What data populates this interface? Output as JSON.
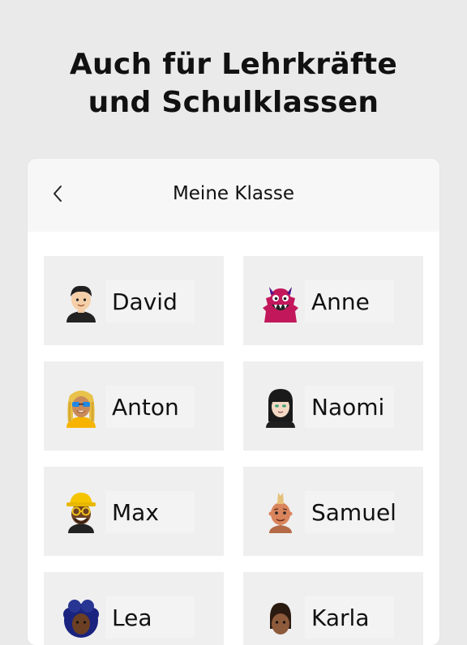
{
  "headline": {
    "line1": "Auch für Lehrkräfte",
    "line2": "und Schulklassen"
  },
  "screen": {
    "title": "Meine Klasse",
    "back_icon": "chevron-left-icon"
  },
  "students": [
    {
      "name": "David",
      "avatar": "boy-avatar-icon"
    },
    {
      "name": "Anne",
      "avatar": "pink-monster-avatar-icon"
    },
    {
      "name": "Anton",
      "avatar": "blonde-sunglasses-avatar-icon"
    },
    {
      "name": "Naomi",
      "avatar": "dark-hair-girl-avatar-icon"
    },
    {
      "name": "Max",
      "avatar": "yellow-hat-glasses-avatar-icon"
    },
    {
      "name": "Samuel",
      "avatar": "mohawk-boy-avatar-icon"
    },
    {
      "name": "Lea",
      "avatar": "curly-hair-girl-avatar-icon"
    },
    {
      "name": "Karla",
      "avatar": "dark-hair-avatar-icon"
    }
  ]
}
